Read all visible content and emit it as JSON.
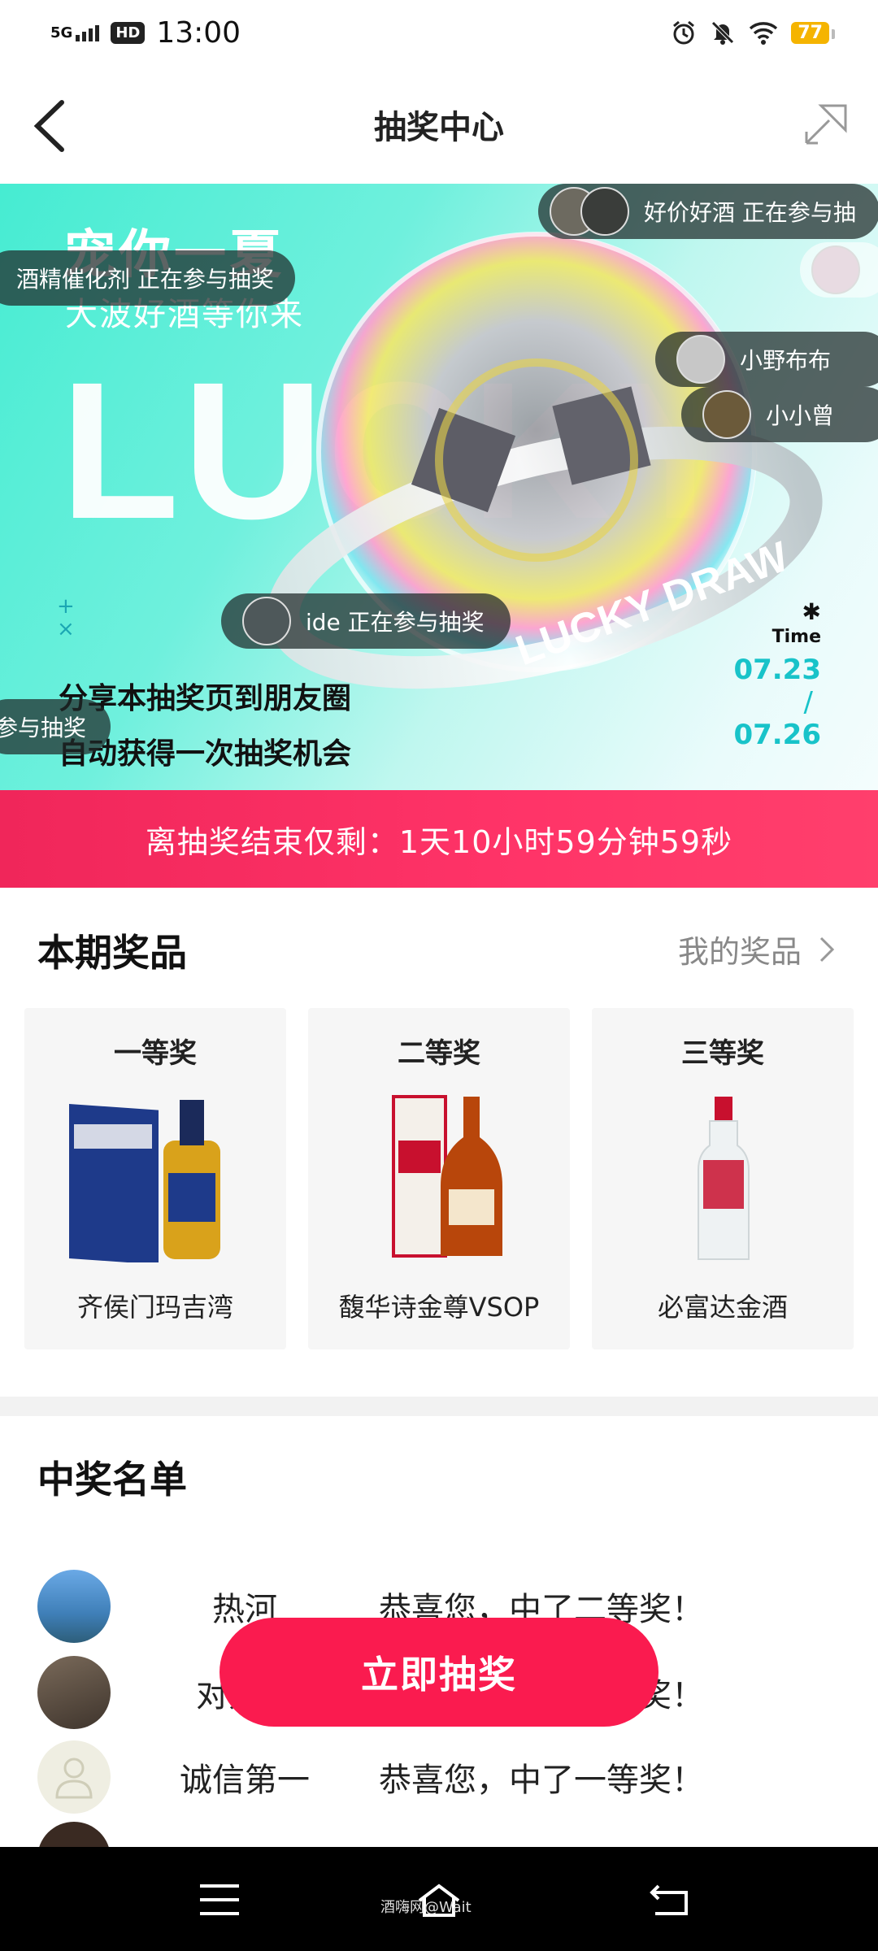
{
  "status_bar": {
    "time": "13:00",
    "network": "5G",
    "hd": "HD",
    "battery": "77"
  },
  "nav": {
    "title": "抽奖中心"
  },
  "banner": {
    "title": "宠你一夏",
    "subtitle": "大波好酒等你来",
    "big_text": "LUCKY",
    "ring_text": "LUCKY DRAW",
    "share_line1": "分享本抽奖页到朋友圈",
    "share_line2": "自动获得一次抽奖机会",
    "time_label": "Time",
    "date_start": "07.23",
    "date_sep": "/",
    "date_end": "07.26",
    "bubbles": [
      {
        "text": "酒精催化剂 正在参与抽奖"
      },
      {
        "text": "好价好酒 正在参与抽"
      },
      {
        "text": "小野布布"
      },
      {
        "text": "小小曾"
      },
      {
        "text": "ide 正在参与抽奖"
      },
      {
        "text": "参与抽奖"
      }
    ]
  },
  "countdown": {
    "text": "离抽奖结束仅剩：1天10小时59分钟59秒"
  },
  "prizes": {
    "heading": "本期奖品",
    "my_prizes_link": "我的奖品",
    "items": [
      {
        "rank": "一等奖",
        "name": "齐侯门玛吉湾"
      },
      {
        "rank": "二等奖",
        "name": "馥华诗金尊VSOP"
      },
      {
        "rank": "三等奖",
        "name": "必富达金酒"
      }
    ]
  },
  "winners": {
    "heading": "中奖名单",
    "items": [
      {
        "name": "热河",
        "message": "恭喜您，中了二等奖！"
      },
      {
        "name": "对方正",
        "message": "恭喜您，中了一等奖！"
      },
      {
        "name": "诚信第一",
        "message": "恭喜您，中了一等奖！"
      }
    ]
  },
  "draw_button": {
    "label": "立即抽奖"
  },
  "system_nav": {
    "watermark": "酒嗨网@Wait"
  },
  "colors": {
    "accent": "#fa1b4f",
    "countdown_bg": "#f0265a",
    "banner_teal": "#46ecd2",
    "date_cyan": "#18c3c9"
  }
}
